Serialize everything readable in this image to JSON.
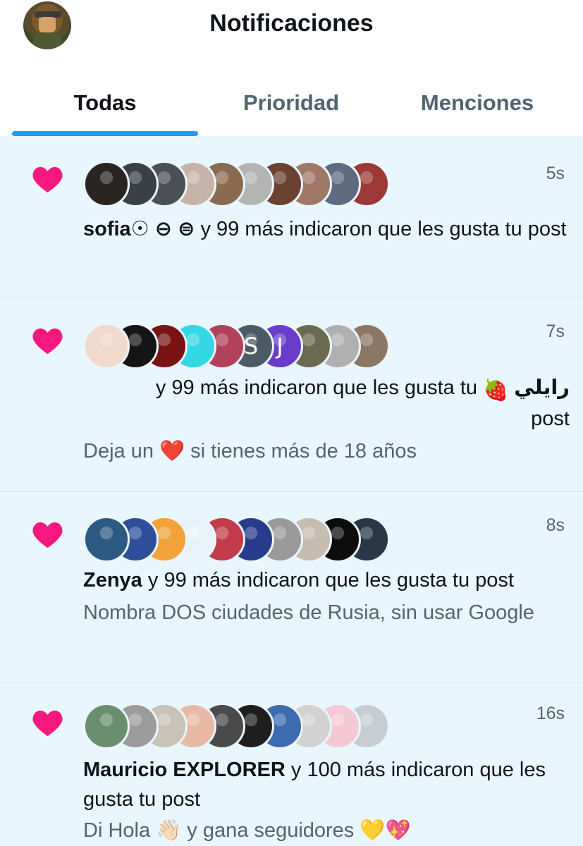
{
  "header": {
    "title": "Notificaciones",
    "tabs": [
      {
        "label": "Todas",
        "active": true
      },
      {
        "label": "Prioridad",
        "active": false
      },
      {
        "label": "Menciones",
        "active": false
      }
    ],
    "accent_color": "#1d9bf0"
  },
  "notifications": [
    {
      "icon": "heart-icon",
      "time": "5s",
      "actor": "sofia☉ ⊖ ⊜",
      "text": " y 99 más indicaron que les gusta tu post",
      "detail": "",
      "avatar_colors": [
        "#2b2521",
        "#3a4046",
        "#4b5057",
        "#c7b3a8",
        "#8a6b52",
        "#b4b4b4",
        "#6a4330",
        "#a07866",
        "#5f6b80",
        "#9b3a36"
      ]
    },
    {
      "icon": "heart-icon",
      "time": "7s",
      "actor": "رايلي",
      "text": "y 99 más indicaron que les gusta tu",
      "text_end": "post",
      "detail": "Deja un ❤️ si tienes más de 18 años",
      "avatar_colors": [
        "#f1d9cc",
        "#151515",
        "#7a1414",
        "#34d8e4",
        "#b2425c",
        "#4c5a66",
        "#6a3cc9",
        "#6b6b52",
        "#b0b0b0",
        "#8c7765"
      ],
      "avatar_letters": [
        "",
        "",
        "",
        "",
        "",
        "S",
        "J",
        "",
        "",
        ""
      ]
    },
    {
      "icon": "heart-icon",
      "time": "8s",
      "actor": "Zenya",
      "text": " y 99 más indicaron que les gusta tu post",
      "detail": "Nombra DOS ciudades de Rusia, sin usar Google",
      "avatar_colors": [
        "#2d5a82",
        "#2f4f9a",
        "#f1a23a",
        "#e7f3f8",
        "#c23c4c",
        "#283c8c",
        "#9a9a9a",
        "#c6bcb0",
        "#0c0c0c",
        "#283848"
      ]
    },
    {
      "icon": "heart-icon",
      "time": "16s",
      "actor": "Mauricio EXPLORER",
      "text": " y 100 más indicaron que les gusta tu post",
      "detail": "Di Hola 👋🏻 y gana seguidores 💛💖",
      "avatar_colors": [
        "#6a8f6e",
        "#9c9c9c",
        "#c9c2b6",
        "#e7b9a4",
        "#4a4a4a",
        "#1f1f1f",
        "#3d6bb0",
        "#d2d2d2",
        "#f3c9d4",
        "#c7cdd3"
      ]
    }
  ]
}
